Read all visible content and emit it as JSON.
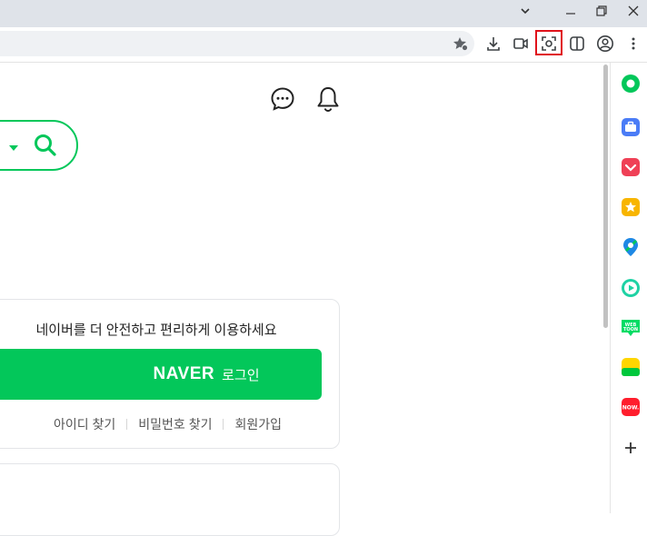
{
  "colors": {
    "naver_green": "#03c75a",
    "highlight_red": "#e0121b",
    "titlebar_bg": "#dfe3e9"
  },
  "window": {
    "controls": [
      "chevron-down-icon",
      "minimize-icon",
      "restore-icon",
      "close-icon"
    ]
  },
  "toolbar": {
    "icons": [
      "bookmark-star-icon",
      "download-icon",
      "video-icon",
      "screenshot-icon",
      "split-view-icon",
      "profile-icon",
      "more-icon"
    ]
  },
  "header": {
    "icons": [
      "chat-icon",
      "bell-icon"
    ]
  },
  "login": {
    "message": "네이버를 더 안전하고 편리하게 이용하세요",
    "button_brand": "NAVER",
    "button_label": "로그인",
    "links": [
      "아이디 찾기",
      "비밀번호 찾기",
      "회원가입"
    ]
  },
  "sidebar": {
    "icons": [
      "naver-icon",
      "briefcase-icon",
      "pocket-icon",
      "star-icon",
      "map-pin-icon",
      "play-icon",
      "webtoon-icon",
      "memo-icon",
      "now-icon",
      "add-icon"
    ]
  }
}
